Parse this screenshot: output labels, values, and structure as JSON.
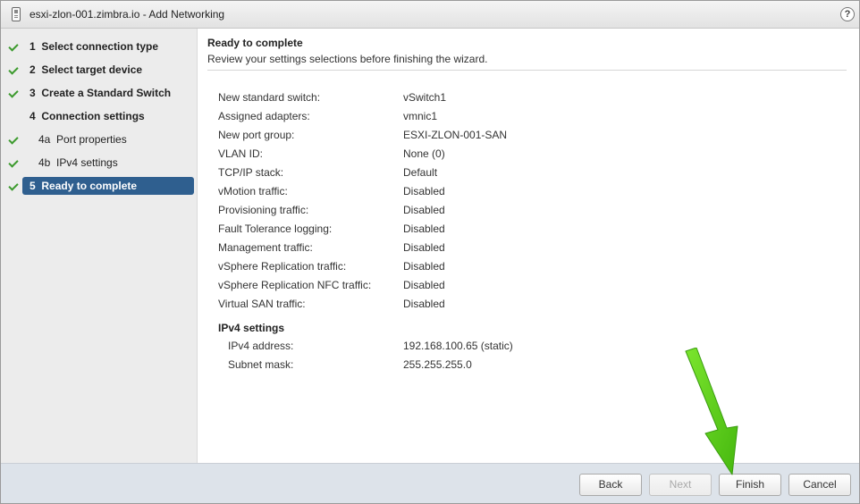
{
  "window": {
    "title": "esxi-zlon-001.zimbra.io - Add Networking",
    "help_label": "?"
  },
  "steps": [
    {
      "num": "1",
      "label": "Select connection type",
      "completed": true
    },
    {
      "num": "2",
      "label": "Select target device",
      "completed": true
    },
    {
      "num": "3",
      "label": "Create a Standard Switch",
      "completed": true
    },
    {
      "num": "4",
      "label": "Connection settings",
      "completed": false
    },
    {
      "num": "4a",
      "label": "Port properties",
      "completed": true
    },
    {
      "num": "4b",
      "label": "IPv4 settings",
      "completed": true
    },
    {
      "num": "5",
      "label": "Ready to complete",
      "completed": true,
      "active": true
    }
  ],
  "content": {
    "heading": "Ready to complete",
    "subheading": "Review your settings selections before finishing the wizard.",
    "settings": [
      {
        "label": "New standard switch:",
        "value": "vSwitch1"
      },
      {
        "label": "Assigned adapters:",
        "value": "vmnic1"
      },
      {
        "label": "New port group:",
        "value": "ESXI-ZLON-001-SAN"
      },
      {
        "label": "VLAN ID:",
        "value": "None (0)"
      },
      {
        "label": "TCP/IP stack:",
        "value": "Default"
      },
      {
        "label": "vMotion traffic:",
        "value": "Disabled"
      },
      {
        "label": "Provisioning traffic:",
        "value": "Disabled"
      },
      {
        "label": "Fault Tolerance logging:",
        "value": "Disabled"
      },
      {
        "label": "Management traffic:",
        "value": "Disabled"
      },
      {
        "label": "vSphere Replication traffic:",
        "value": "Disabled"
      },
      {
        "label": "vSphere Replication NFC traffic:",
        "value": "Disabled"
      },
      {
        "label": "Virtual SAN traffic:",
        "value": "Disabled"
      }
    ],
    "ipv4_title": "IPv4 settings",
    "ipv4": [
      {
        "label": "IPv4 address:",
        "value": "192.168.100.65 (static)"
      },
      {
        "label": "Subnet mask:",
        "value": "255.255.255.0"
      }
    ]
  },
  "footer": {
    "back_label": "Back",
    "next_label": "Next",
    "finish_label": "Finish",
    "cancel_label": "Cancel"
  },
  "colors": {
    "active_step": "#2f5f8f",
    "check": "#3c9a2d",
    "annotation_arrow": "#5fd11a"
  },
  "icons": {
    "title": "host-icon",
    "help": "help-icon",
    "check": "check-icon",
    "annotation": "green-arrow-annotation"
  }
}
